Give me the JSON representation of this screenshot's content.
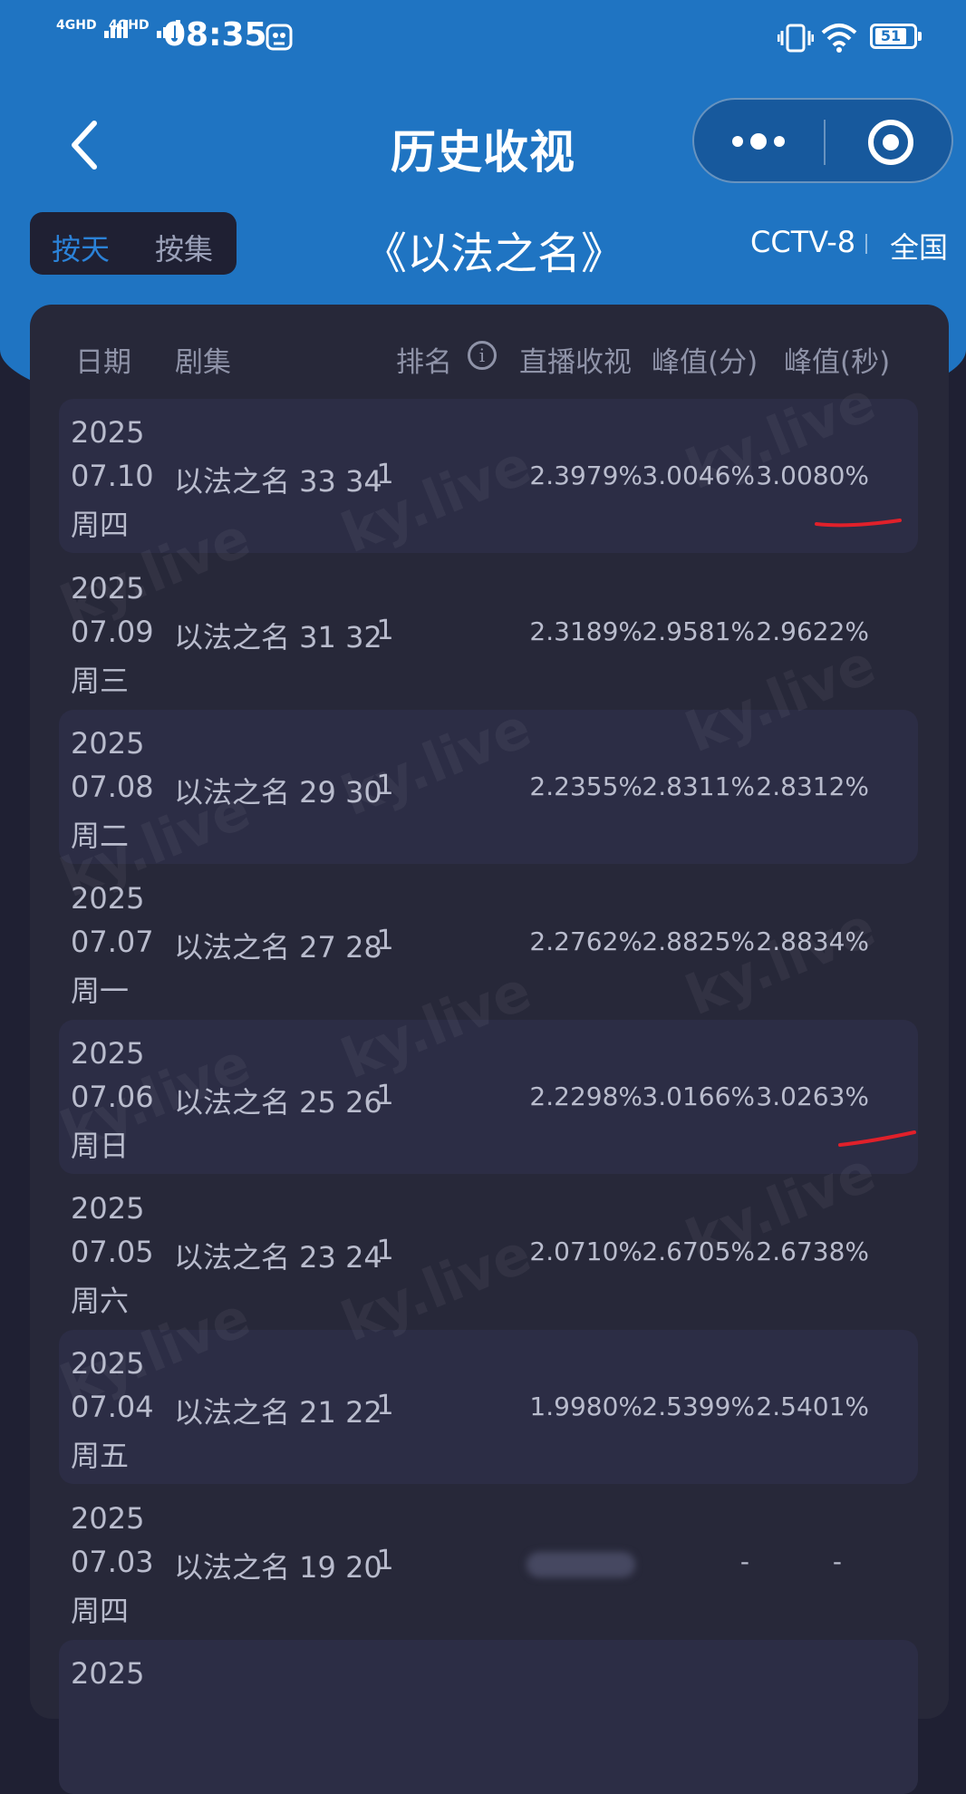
{
  "status_bar": {
    "network1": "4GHD",
    "network2": "4GHD",
    "time": "08:35",
    "battery": "51",
    "icons": [
      "signal-icon",
      "signal-icon",
      "screenshot-icon",
      "vibrate-icon",
      "wifi-icon",
      "battery-icon"
    ]
  },
  "nav": {
    "title": "历史收视",
    "back_icon": "chevron-left-icon",
    "more_icon": "more-dots-icon",
    "close_icon": "target-icon"
  },
  "filters": {
    "by_day": "按天",
    "by_episode": "按集",
    "drama_title": "《以法之名》",
    "channel": "CCTV-8",
    "region": "全国"
  },
  "table": {
    "headers": {
      "date": "日期",
      "episode": "剧集",
      "rank": "排名",
      "live_rating": "直播收视",
      "peak_min": "峰值(分)",
      "peak_sec": "峰值(秒)"
    },
    "rows": [
      {
        "year": "2025",
        "date": "07.10",
        "weekday": "周四",
        "episode": "以法之名 33 34",
        "rank": "1",
        "live": "2.3979%",
        "peak_min": "3.0046%",
        "peak_sec": "3.0080%"
      },
      {
        "year": "2025",
        "date": "07.09",
        "weekday": "周三",
        "episode": "以法之名 31 32",
        "rank": "1",
        "live": "2.3189%",
        "peak_min": "2.9581%",
        "peak_sec": "2.9622%"
      },
      {
        "year": "2025",
        "date": "07.08",
        "weekday": "周二",
        "episode": "以法之名 29 30",
        "rank": "1",
        "live": "2.2355%",
        "peak_min": "2.8311%",
        "peak_sec": "2.8312%"
      },
      {
        "year": "2025",
        "date": "07.07",
        "weekday": "周一",
        "episode": "以法之名 27 28",
        "rank": "1",
        "live": "2.2762%",
        "peak_min": "2.8825%",
        "peak_sec": "2.8834%"
      },
      {
        "year": "2025",
        "date": "07.06",
        "weekday": "周日",
        "episode": "以法之名 25 26",
        "rank": "1",
        "live": "2.2298%",
        "peak_min": "3.0166%",
        "peak_sec": "3.0263%"
      },
      {
        "year": "2025",
        "date": "07.05",
        "weekday": "周六",
        "episode": "以法之名 23 24",
        "rank": "1",
        "live": "2.0710%",
        "peak_min": "2.6705%",
        "peak_sec": "2.6738%"
      },
      {
        "year": "2025",
        "date": "07.04",
        "weekday": "周五",
        "episode": "以法之名 21 22",
        "rank": "1",
        "live": "1.9980%",
        "peak_min": "2.5399%",
        "peak_sec": "2.5401%"
      },
      {
        "year": "2025",
        "date": "07.03",
        "weekday": "周四",
        "episode": "以法之名 19 20",
        "rank": "1",
        "live": "",
        "peak_min": "-",
        "peak_sec": "-"
      },
      {
        "year": "2025"
      }
    ]
  },
  "watermark": "ky.live",
  "colors": {
    "header_blue": "#1f74c2",
    "background": "#1f2033",
    "panel": "#272839",
    "row_shade": "#2c2d45",
    "active_tab": "#2b82d8",
    "annotation_red": "#e0202a"
  }
}
